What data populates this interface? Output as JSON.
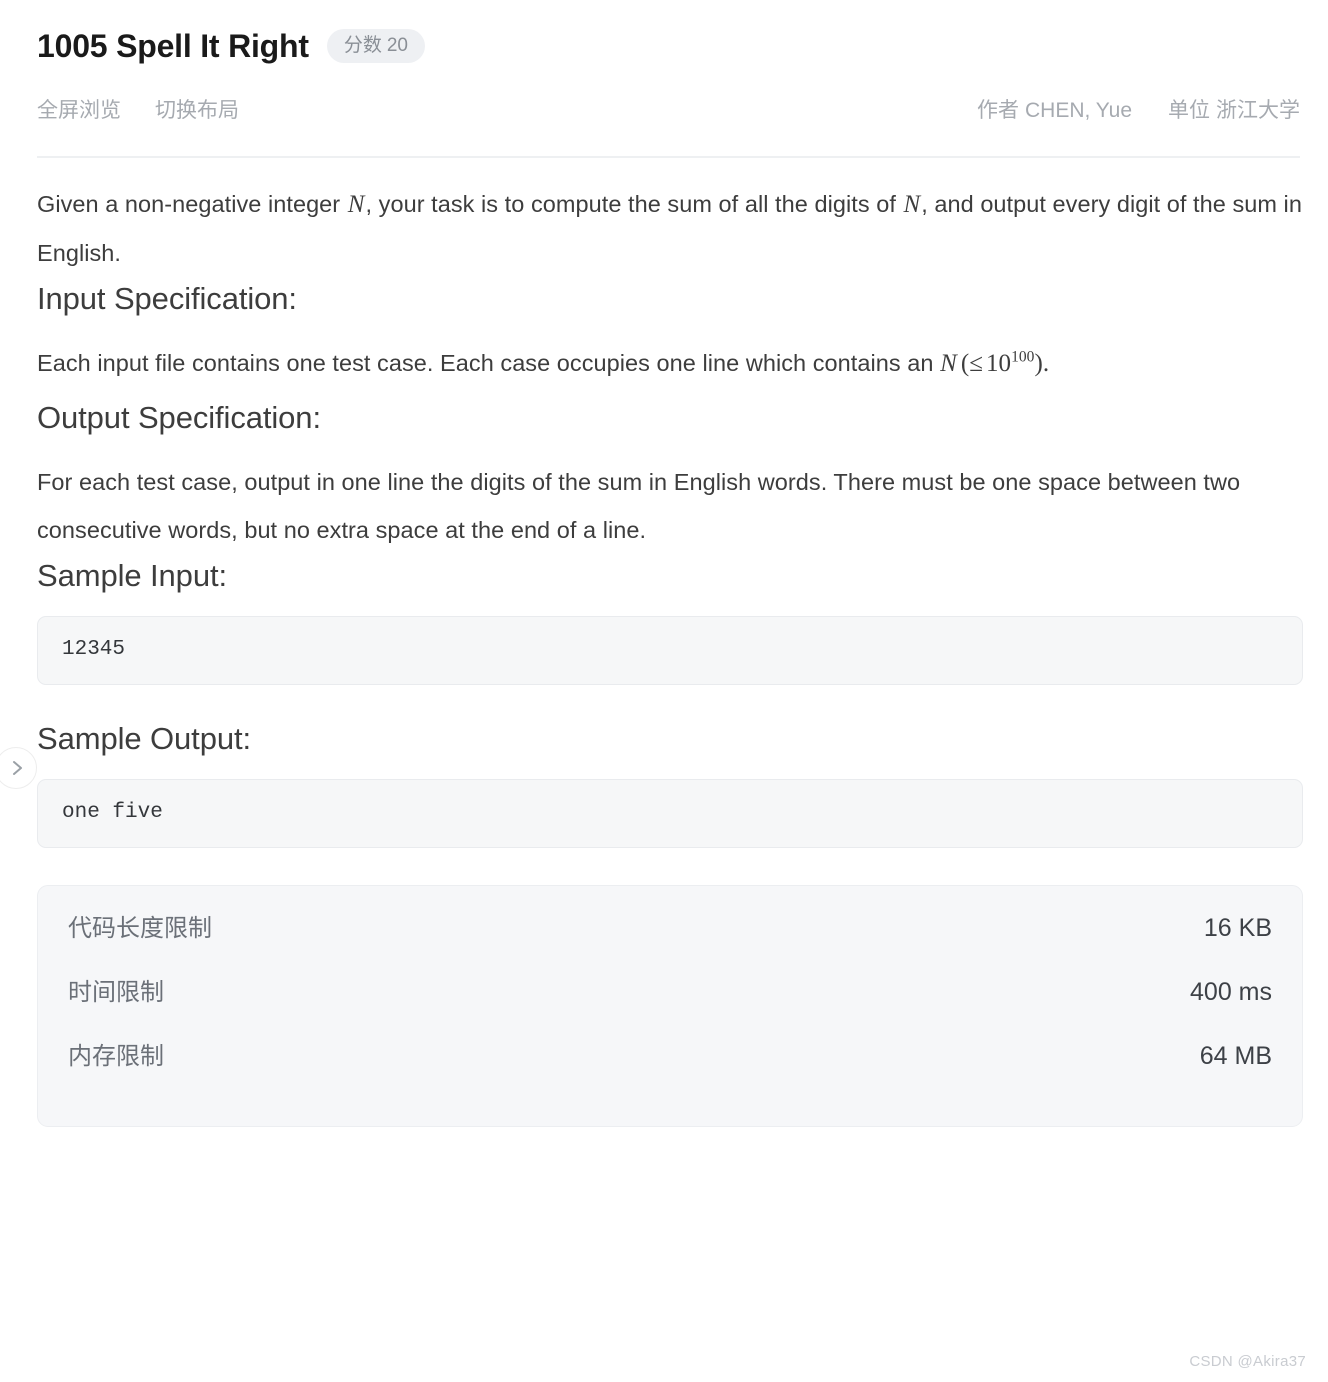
{
  "header": {
    "title": "1005 Spell It Right",
    "score_label": "分数",
    "score_value": "20",
    "actions": [
      {
        "label": "全屏浏览",
        "name": "fullscreen-view"
      },
      {
        "label": "切换布局",
        "name": "toggle-layout"
      }
    ],
    "author_key": "作者",
    "author_value": "CHEN, Yue",
    "org_key": "单位",
    "org_value": "浙江大学"
  },
  "description": {
    "p1_a": "Given a non-negative integer ",
    "p1_math_n1": "N",
    "p1_b": ", your task is to compute the sum of all the digits of ",
    "p1_math_n2": "N",
    "p1_c": ", and output every digit of the sum in English."
  },
  "input_spec": {
    "heading": "Input Specification:",
    "text_a": "Each input file contains one test case. Each case occupies one line which contains an ",
    "math_var": "N",
    "math_op": "(≤",
    "math_base": "10",
    "math_exp": "100",
    "math_close": ").",
    "full_math": "N (≤ 10^100)."
  },
  "output_spec": {
    "heading": "Output Specification:",
    "text": "For each test case, output in one line the digits of the sum in English words. There must be one space between two consecutive words, but no extra space at the end of a line."
  },
  "sample_input": {
    "heading": "Sample Input:",
    "code": "12345"
  },
  "sample_output": {
    "heading": "Sample Output:",
    "code": "one five"
  },
  "limits": {
    "rows": [
      {
        "label": "代码长度限制",
        "value": "16 KB"
      },
      {
        "label": "时间限制",
        "value": "400 ms"
      },
      {
        "label": "内存限制",
        "value": "64 MB"
      }
    ]
  },
  "side_toggle": {
    "icon": "chevron-right-icon"
  },
  "watermark": {
    "text": "CSDN @Akira37"
  },
  "colors": {
    "title": "#1a1a1a",
    "body_text": "#3d3d3d",
    "muted_text": "#a6aab0",
    "badge_bg": "#eef0f3",
    "panel_bg": "#f6f7f9",
    "code_bg": "#f6f7f8",
    "border": "#e9ebee",
    "divider": "#eef0f2"
  }
}
